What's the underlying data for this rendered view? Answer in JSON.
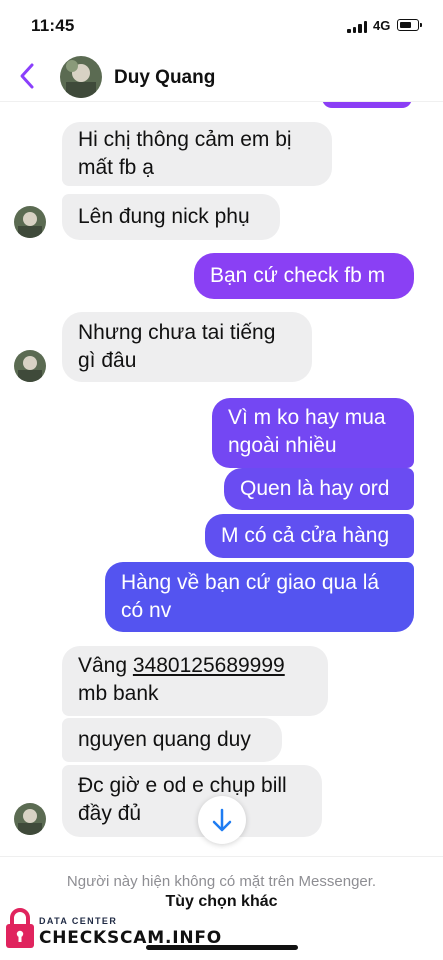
{
  "status_bar": {
    "time": "11:45",
    "network": "4G",
    "battery_level": 0.7
  },
  "header": {
    "contact_name": "Duy Quang",
    "back_icon": "chevron-left-icon"
  },
  "colors": {
    "accent": "#8a3ffc",
    "outgoing_top": "#8b3ef5",
    "outgoing_bottom": "#4f58f0",
    "incoming": "#eeeeef"
  },
  "messages": [
    {
      "direction": "in",
      "lines": [
        "Hi chị thông cảm em bị",
        "mất fb ạ"
      ]
    },
    {
      "direction": "in",
      "lines": [
        "Lên đung nick phụ"
      ]
    },
    {
      "direction": "out",
      "lines": [
        "Bạn cứ check fb m"
      ]
    },
    {
      "direction": "in",
      "lines": [
        "Nhưng chưa tai tiếng",
        "gì đâu"
      ]
    },
    {
      "direction": "out",
      "lines": [
        "Vì m ko hay mua",
        "ngoài nhiều"
      ]
    },
    {
      "direction": "out",
      "lines": [
        "Quen là hay ord"
      ]
    },
    {
      "direction": "out",
      "lines": [
        "M có cả cửa hàng"
      ]
    },
    {
      "direction": "out",
      "lines": [
        "Hàng về bạn cứ giao qua lá",
        "có nv"
      ]
    },
    {
      "direction": "in",
      "prefix": "Vâng ",
      "account": "3480125689999",
      "lines2": "mb bank"
    },
    {
      "direction": "in",
      "lines": [
        "nguyen quang duy"
      ]
    },
    {
      "direction": "in",
      "lines": [
        "Đc giờ e od e chụp bill",
        "đầy đủ"
      ]
    }
  ],
  "footer": {
    "note": "Người này hiện không có mặt trên Messenger.",
    "link": "Tùy chọn khác"
  },
  "watermark": {
    "small": "DATA CENTER",
    "big": "CHECKSCAM.INFO"
  },
  "icons": {
    "scroll": "arrow-down-icon",
    "lock": "lock-icon"
  }
}
